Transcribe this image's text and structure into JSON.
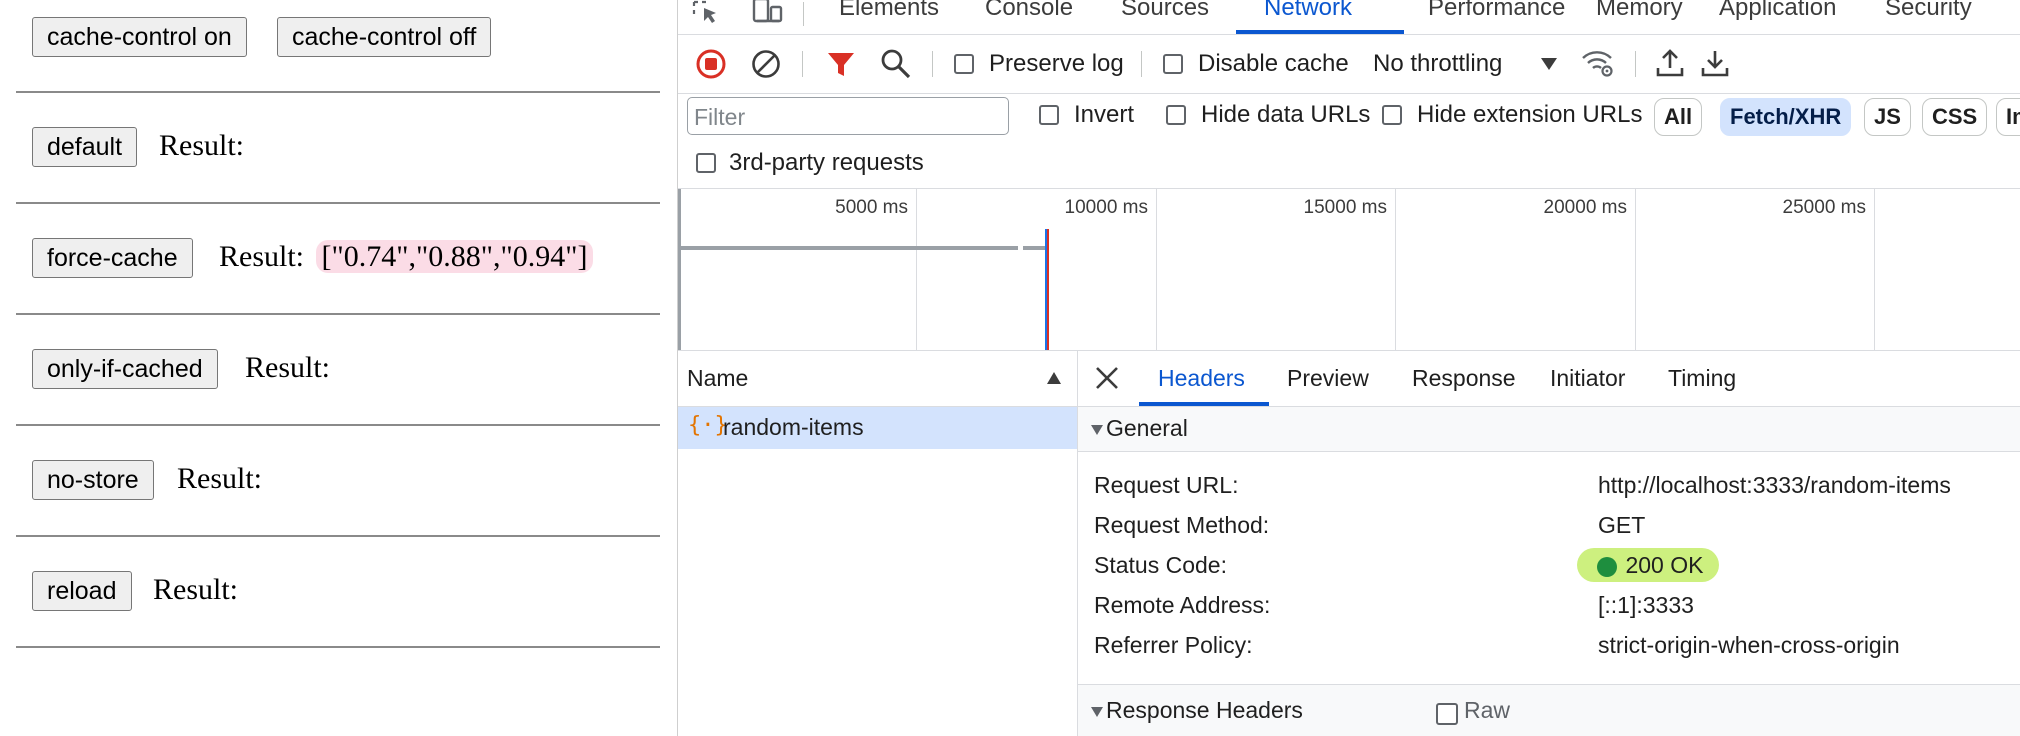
{
  "page": {
    "header_buttons": [
      "cache-control on",
      "cache-control off"
    ],
    "result_label": "Result:",
    "rows": [
      {
        "button": "default",
        "value": ""
      },
      {
        "button": "force-cache",
        "value": "[\"0.74\",\"0.88\",\"0.94\"]"
      },
      {
        "button": "only-if-cached",
        "value": ""
      },
      {
        "button": "no-store",
        "value": ""
      },
      {
        "button": "reload",
        "value": ""
      }
    ]
  },
  "devtools": {
    "tabs": [
      "Elements",
      "Console",
      "Sources",
      "Network",
      "Performance",
      "Memory",
      "Application",
      "Security"
    ],
    "active_tab": "Network",
    "toolbar": {
      "preserve_log": "Preserve log",
      "disable_cache": "Disable cache",
      "throttling": "No throttling"
    },
    "filter": {
      "placeholder": "Filter",
      "invert": "Invert",
      "hide_data_urls": "Hide data URLs",
      "hide_extension_urls": "Hide extension URLs",
      "chips": [
        "All",
        "Fetch/XHR",
        "JS",
        "CSS",
        "Img"
      ],
      "active_chip": "Fetch/XHR",
      "third_party": "3rd-party requests"
    },
    "overview_ticks": [
      "5000 ms",
      "10000 ms",
      "15000 ms",
      "20000 ms",
      "25000 ms"
    ],
    "request_list": {
      "column": "Name",
      "items": [
        "random-items"
      ]
    },
    "details": {
      "tabs": [
        "Headers",
        "Preview",
        "Response",
        "Initiator",
        "Timing"
      ],
      "active_tab": "Headers",
      "general_title": "General",
      "general": [
        {
          "label": "Request URL:",
          "value": "http://localhost:3333/random-items"
        },
        {
          "label": "Request Method:",
          "value": "GET"
        },
        {
          "label": "Status Code:",
          "value": "200 OK"
        },
        {
          "label": "Remote Address:",
          "value": "[::1]:3333"
        },
        {
          "label": "Referrer Policy:",
          "value": "strict-origin-when-cross-origin"
        }
      ],
      "response_headers_title": "Response Headers",
      "raw_label": "Raw"
    },
    "colors": {
      "accent": "#0b57d0",
      "record": "#d93025",
      "status_ok": "#1e8e3e",
      "status_bg": "#cdf07f"
    }
  }
}
